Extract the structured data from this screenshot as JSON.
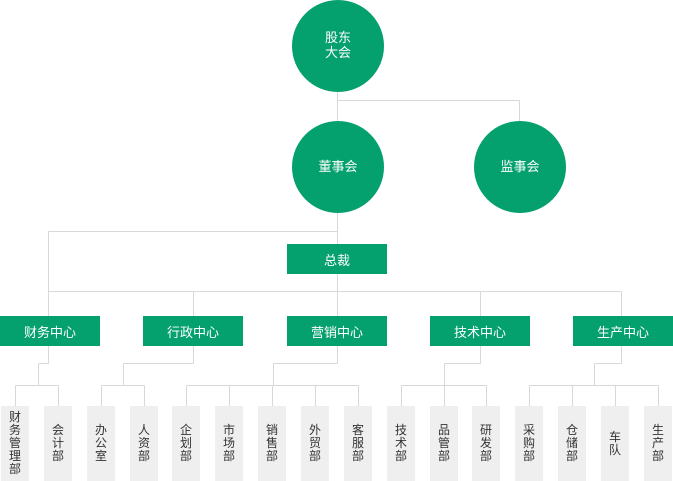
{
  "colors": {
    "node": "#04a06d",
    "node_text": "#ffffff",
    "line": "#d8d8d8",
    "dept_bg": "#efefef",
    "dept_text": "#333333"
  },
  "shareholders": "股东\n大会",
  "board": "董事会",
  "supervisors": "监事会",
  "president": "总裁",
  "centers": [
    {
      "label": "财务中心",
      "depts": [
        "财务管理部",
        "会计部"
      ]
    },
    {
      "label": "行政中心",
      "depts": [
        "办公室",
        "人资部"
      ]
    },
    {
      "label": "营销中心",
      "depts": [
        "企划部",
        "市场部",
        "销售部",
        "外贸部",
        "客服部"
      ]
    },
    {
      "label": "技术中心",
      "depts": [
        "技术部",
        "品管部",
        "研发部"
      ]
    },
    {
      "label": "生产中心",
      "depts": [
        "采购部",
        "仓储部",
        "车队",
        "生产部"
      ]
    }
  ]
}
